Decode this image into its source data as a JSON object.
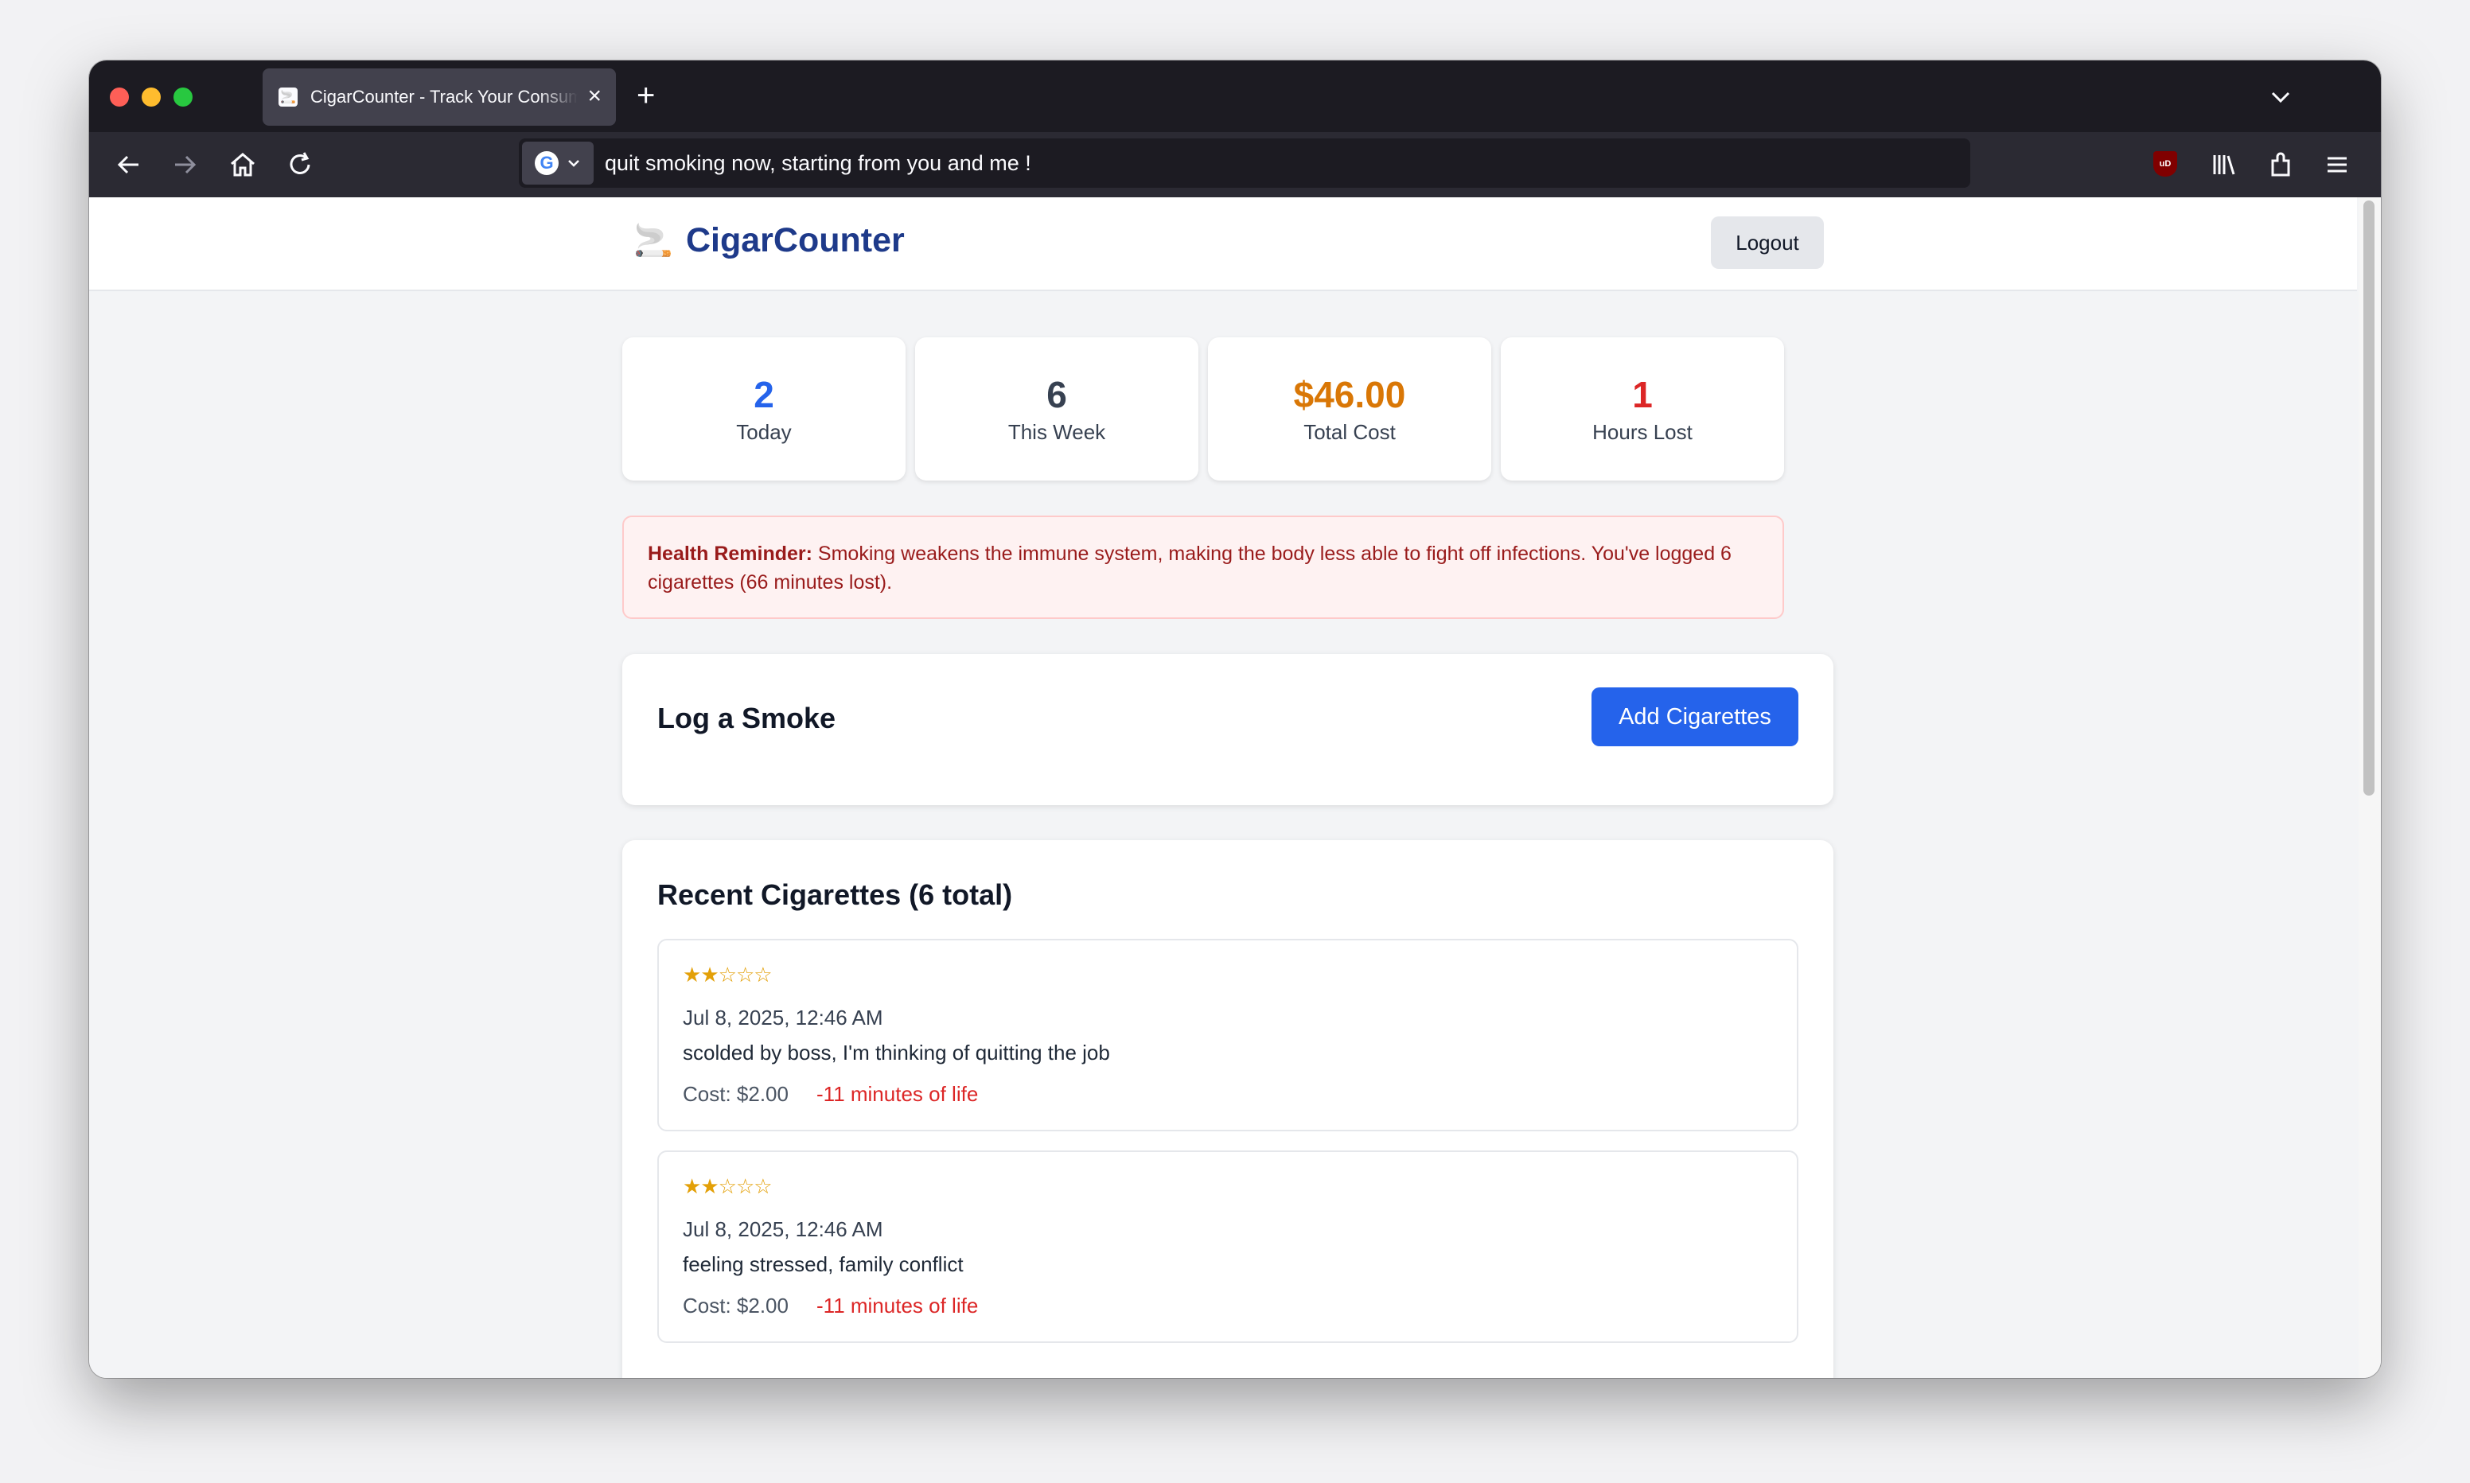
{
  "browser": {
    "tab_title": "CigarCounter - Track Your Consumption",
    "url": "quit smoking now, starting from you and me !",
    "ublock_label": "uD"
  },
  "app": {
    "brand_icon": "🚬",
    "brand_name": "CigarCounter",
    "logout_label": "Logout"
  },
  "stats": [
    {
      "value": "2",
      "label": "Today",
      "color": "#2563eb"
    },
    {
      "value": "6",
      "label": "This Week",
      "color": "#374151"
    },
    {
      "value": "$46.00",
      "label": "Total Cost",
      "color": "#d97706"
    },
    {
      "value": "1",
      "label": "Hours Lost",
      "color": "#dc2626"
    }
  ],
  "health_reminder": {
    "title": "Health Reminder:",
    "text": " Smoking weakens the immune system, making the body less able to fight off infections. You've logged 6 cigarettes (66 minutes lost)."
  },
  "log": {
    "title": "Log a Smoke",
    "button_label": "Add Cigarettes"
  },
  "recent": {
    "title": "Recent Cigarettes (6 total)",
    "entries": [
      {
        "rating": 2,
        "max_rating": 5,
        "date": "Jul 8, 2025, 12:46 AM",
        "note": "scolded by boss, I'm thinking of quitting the job",
        "cost": "Cost: $2.00",
        "life": "-11 minutes of life"
      },
      {
        "rating": 2,
        "max_rating": 5,
        "date": "Jul 8, 2025, 12:46 AM",
        "note": "feeling stressed, family conflict",
        "cost": "Cost: $2.00",
        "life": "-11 minutes of life"
      }
    ]
  },
  "colors": {
    "brand": "#1e3a8a",
    "primary_button": "#2563eb",
    "alert_bg": "#fef2f2",
    "alert_text": "#991b1b",
    "star": "#e3a008",
    "danger": "#dc2626"
  }
}
